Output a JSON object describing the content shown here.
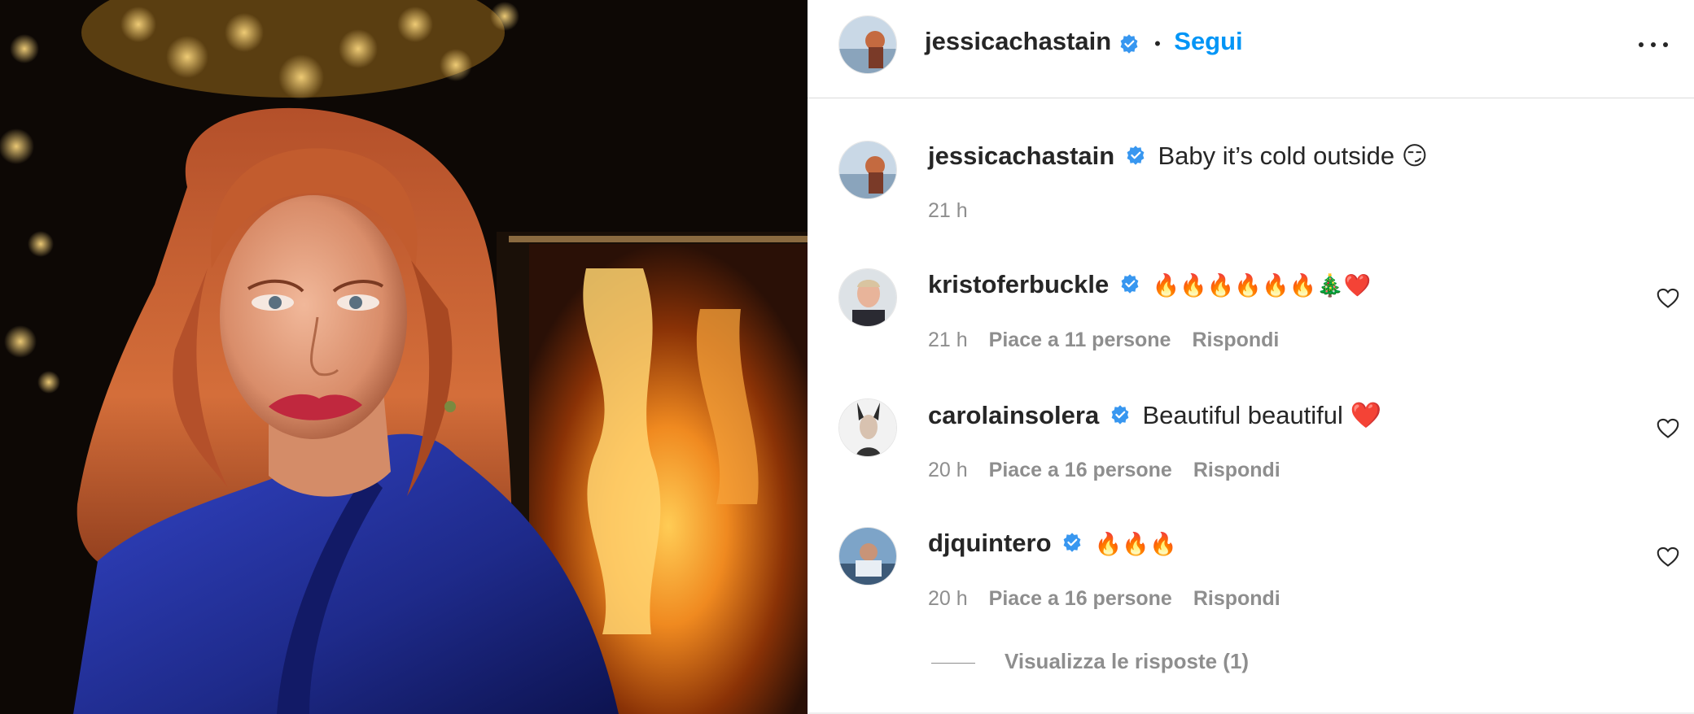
{
  "post": {
    "author": "jessicachastain",
    "follow_label": "Segui",
    "separator": "•",
    "caption": {
      "username": "jessicachastain",
      "text": "Baby it’s cold outside 😏",
      "time": "21 h"
    }
  },
  "comments": [
    {
      "username": "kristoferbuckle",
      "text": "🔥🔥🔥🔥🔥🔥🎄❤️",
      "time": "21 h",
      "likes": "Piace a 11 persone",
      "reply": "Rispondi"
    },
    {
      "username": "carolainsolera",
      "text": "Beautiful beautiful ❤️",
      "time": "20 h",
      "likes": "Piace a 16 persone",
      "reply": "Rispondi"
    },
    {
      "username": "djquintero",
      "text": "🔥🔥🔥",
      "time": "20 h",
      "likes": "Piace a 16 persone",
      "reply": "Rispondi"
    }
  ],
  "view_replies": "Visualizza le risposte (1)",
  "colors": {
    "accent": "#0095f6",
    "verified": "#3897f0",
    "muted": "#8e8e8e",
    "text": "#262626"
  },
  "icons": {
    "verified": "verified-badge-icon",
    "more": "more-options-icon",
    "like": "heart-outline-icon"
  }
}
